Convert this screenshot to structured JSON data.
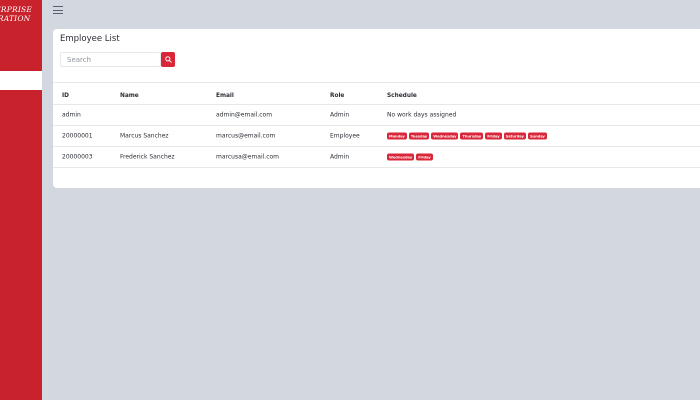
{
  "sidebar": {
    "brand_line1": "TERPRISE",
    "brand_line2": "ORATION",
    "item2_label": "s"
  },
  "card": {
    "title": "Employee List",
    "search_placeholder": "Search"
  },
  "table": {
    "headers": {
      "id": "ID",
      "name": "Name",
      "email": "Email",
      "role": "Role",
      "schedule": "Schedule"
    },
    "rows": [
      {
        "id": "admin",
        "name": "",
        "email": "admin@email.com",
        "role": "Admin",
        "schedule_text": "No work days assigned"
      },
      {
        "id": "20000001",
        "name": "Marcus Sanchez",
        "email": "marcus@email.com",
        "role": "Employee",
        "days": [
          "Monday",
          "Tuesday",
          "Wednesday",
          "Thursday",
          "Friday",
          "Saturday",
          "Sunday"
        ]
      },
      {
        "id": "20000003",
        "name": "Frederick Sanchez",
        "email": "marcusa@email.com",
        "role": "Admin",
        "days": [
          "Wednesday",
          "Friday"
        ]
      }
    ]
  },
  "colors": {
    "sidebar": "#c8232c",
    "accent": "#d92638",
    "background": "#d3d8e0"
  }
}
